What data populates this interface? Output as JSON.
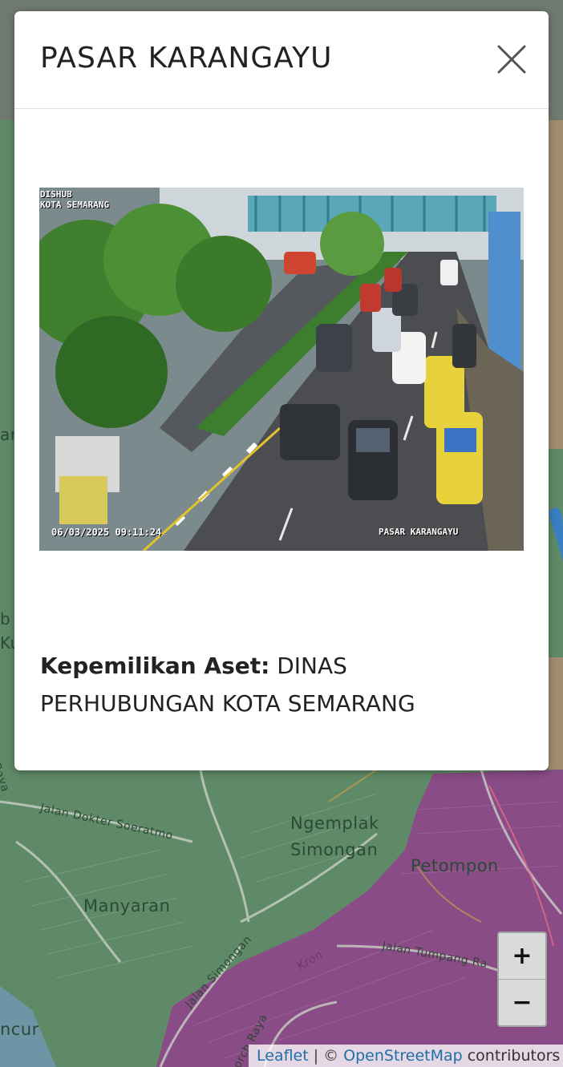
{
  "map": {
    "labels": {
      "jalan_dokter": "Jalan Dokter Soeratmo",
      "ngemplak": "Ngemplak",
      "simongan": "Simongan",
      "petompon": "Petompon",
      "manyaran": "Manyaran",
      "jalan_simongan": "Jalan Simongan",
      "jalan_tumpang": "Jalan Tumpang Ra",
      "ncur": "ncur",
      "raya": "orch Raya",
      "kron": "Kron",
      "edge_ar": "ar",
      "edge_b": "b",
      "edge_ku": "Ku",
      "edge_raya": "Raya"
    },
    "colors": {
      "green_area": "#5e8a67",
      "purple_area": "#8a4c86",
      "road": "#c7cfc4"
    }
  },
  "zoom": {
    "in_label": "+",
    "out_label": "−"
  },
  "attribution": {
    "leaflet": "Leaflet",
    "separator": "| ©",
    "osm": "OpenStreetMap",
    "suffix": "contributors"
  },
  "modal": {
    "title": "PASAR KARANGAYU",
    "close_icon": "close-icon",
    "camera": {
      "top_left_line1": "DISHUB",
      "top_left_line2": "KOTA SEMARANG",
      "timestamp": "06/03/2025 09:11:24",
      "location": "PASAR KARANGAYU"
    },
    "owner_label": "Kepemilikan Aset:",
    "owner_value": "DINAS PERHUBUNGAN KOTA SEMARANG"
  }
}
